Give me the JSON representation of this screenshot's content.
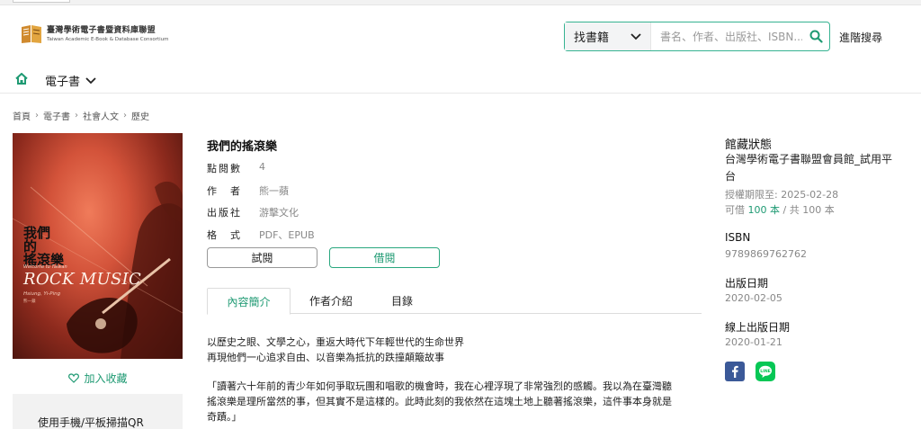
{
  "logo": {
    "title_zh": "臺灣學術電子書暨資料庫聯盟",
    "title_en": "Taiwan Academic E-Book & Database Consortium"
  },
  "search": {
    "category": "找書籍",
    "placeholder": "書名、作者、出版社、ISBN...",
    "advanced_label": "進階搜尋"
  },
  "nav": {
    "ebook_label": "電子書"
  },
  "breadcrumb": [
    "首頁",
    "電子書",
    "社會人文",
    "歷史"
  ],
  "cover": {
    "title_line1": "我們",
    "title_line2": "的",
    "title_line3": "搖滾樂",
    "subtitle": "Welcome to Taiwan",
    "rock_text": "ROCK MUSIC",
    "author_en": "Hsiung, Yi-Ping",
    "author_zh": "熊一蘋"
  },
  "book": {
    "title": "我們的搖滾樂",
    "views_label": "點閱數",
    "views_value": "4",
    "author_label": "作　者",
    "author_value": "熊一蘋",
    "publisher_label": "出版社",
    "publisher_value": "游擊文化",
    "format_label": "格　式",
    "format_value": "PDF、EPUB"
  },
  "actions": {
    "trial_label": "試閱",
    "borrow_label": "借閱",
    "favorite_label": "加入收藏",
    "qr_label": "使用手機/平板掃描QR"
  },
  "tabs": [
    "內容簡介",
    "作者介紹",
    "目錄"
  ],
  "description": {
    "line1": "以歷史之眼、文學之心，重返大時代下年輕世代的生命世界",
    "line2": "再現他們一心追求自由、以音樂為抵抗的跌撞顛簸故事",
    "quote_line1": "「讀著六十年前的青少年如何爭取玩團和唱歌的機會時，我在心裡浮現了非常強烈的感觸。我以為在臺灣聽",
    "quote_line2": "搖滾樂是理所當然的事，但其實不是這樣的。此時此刻的我依然在這塊土地上聽著搖滾樂，這件事本身就是",
    "quote_line3": "奇蹟。」"
  },
  "sidebar": {
    "status_heading": "館藏狀態",
    "library_name": "台灣學術電子書聯盟會員館_試用平台",
    "license_expiry": "授權期限至: 2025-02-28",
    "available_prefix": "可借",
    "available_count": "100 本",
    "available_total": "/ 共 100 本",
    "isbn_heading": "ISBN",
    "isbn_value": "9789869762762",
    "pub_date_heading": "出版日期",
    "pub_date_value": "2020-02-05",
    "online_date_heading": "線上出版日期",
    "online_date_value": "2020-01-21"
  },
  "colors": {
    "accent": "#1f9a73",
    "facebook": "#3b5998",
    "line": "#06c755"
  }
}
